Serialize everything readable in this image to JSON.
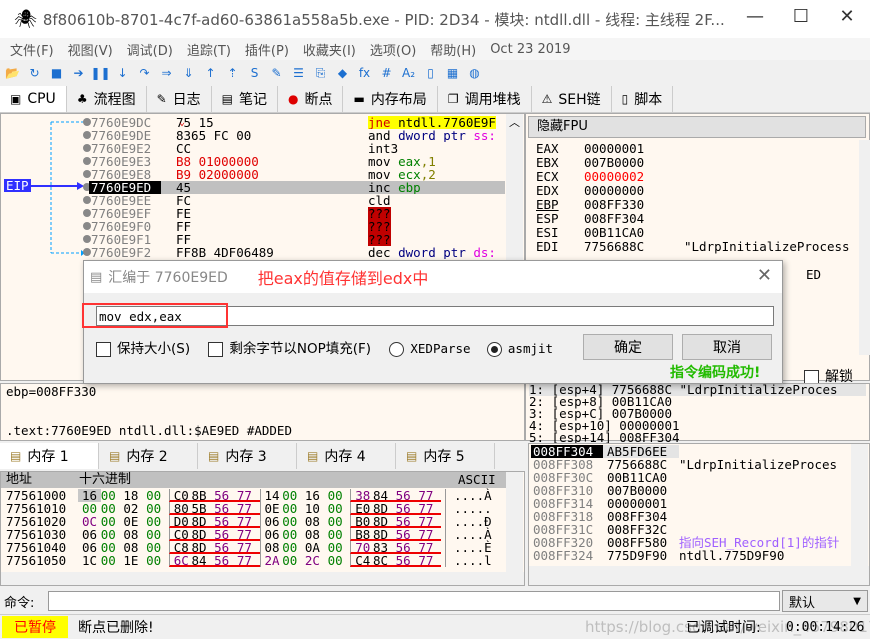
{
  "window": {
    "title": "8f80610b-8701-4c7f-ad60-63861a558a5b.exe - PID: 2D34 - 模块: ntdll.dll - 线程: 主线程 2F...",
    "minimize": "—",
    "maximize": "☐",
    "close": "✕"
  },
  "menu": [
    "文件(F)",
    "视图(V)",
    "调试(D)",
    "追踪(T)",
    "插件(P)",
    "收藏夹(I)",
    "选项(O)",
    "帮助(H)",
    "Oct 23 2019"
  ],
  "toolbar": [
    {
      "icon": "open-icon",
      "glyph": "📂"
    },
    {
      "icon": "restart-icon",
      "glyph": "↻"
    },
    {
      "icon": "stop-icon",
      "glyph": "■"
    },
    {
      "icon": "run-icon",
      "glyph": "➔"
    },
    {
      "icon": "pause-icon",
      "glyph": "❚❚"
    },
    {
      "icon": "step-into-icon",
      "glyph": "↓"
    },
    {
      "icon": "step-over-icon",
      "glyph": "↷"
    },
    {
      "icon": "trace-into-icon",
      "glyph": "⇒"
    },
    {
      "icon": "trace-over-icon",
      "glyph": "⇓"
    },
    {
      "icon": "execute-till-return-icon",
      "glyph": "↑"
    },
    {
      "icon": "run-to-user-code-icon",
      "glyph": "⇡"
    },
    {
      "icon": "scylla-icon",
      "glyph": "S"
    },
    {
      "icon": "patch-icon",
      "glyph": "✎"
    },
    {
      "icon": "comments-icon",
      "glyph": "☰"
    },
    {
      "icon": "labels-icon",
      "glyph": "⎘"
    },
    {
      "icon": "bookmarks-icon",
      "glyph": "◆"
    },
    {
      "icon": "functions-icon",
      "glyph": "fx"
    },
    {
      "icon": "hash-icon",
      "glyph": "#"
    },
    {
      "icon": "strings-icon",
      "glyph": "A₂"
    },
    {
      "icon": "device-icon",
      "glyph": "▯"
    },
    {
      "icon": "calculator-icon",
      "glyph": "▦"
    },
    {
      "icon": "globe-icon",
      "glyph": "◍"
    }
  ],
  "tabs": [
    {
      "label": "CPU",
      "icon": "cpu-icon",
      "glyph": "▣"
    },
    {
      "label": "流程图",
      "icon": "tree-icon",
      "glyph": "♣"
    },
    {
      "label": "日志",
      "icon": "log-icon",
      "glyph": "✎"
    },
    {
      "label": "笔记",
      "icon": "notes-icon",
      "glyph": "▤"
    },
    {
      "label": "断点",
      "icon": "breakpoint-icon",
      "glyph": "●"
    },
    {
      "label": "内存布局",
      "icon": "memory-map-icon",
      "glyph": "▬"
    },
    {
      "label": "调用堆栈",
      "icon": "call-stack-icon",
      "glyph": "❐"
    },
    {
      "label": "SEH链",
      "icon": "seh-icon",
      "glyph": "⚠"
    },
    {
      "label": "脚本",
      "icon": "script-icon",
      "glyph": "▯"
    }
  ],
  "disasm": {
    "eip_label": "EIP",
    "rows": [
      {
        "addr": "7760E9DC",
        "mark": "⌄",
        "bytes": "75 15",
        "instr": [
          [
            "jne ",
            "#d00000",
            "#ffff00"
          ],
          [
            "ntdll.7760E9F",
            "#000",
            "#ffff00"
          ]
        ]
      },
      {
        "addr": "7760E9DE",
        "bytes": "8365 FC 00",
        "instr": [
          [
            "and ",
            "#000"
          ],
          [
            "dword ptr ",
            "#000080"
          ],
          [
            "ss:",
            "#e000e0"
          ]
        ]
      },
      {
        "addr": "7760E9E2",
        "bytes": "CC",
        "instr": [
          [
            "int3",
            "#000"
          ]
        ]
      },
      {
        "addr": "7760E9E3",
        "bytes": "B8 01000000",
        "red": true,
        "instr": [
          [
            "mov ",
            "#000"
          ],
          [
            "eax",
            "#008000"
          ],
          [
            ",1",
            "#808000"
          ]
        ]
      },
      {
        "addr": "7760E9E8",
        "bytes": "B9 02000000",
        "red": true,
        "instr": [
          [
            "mov ",
            "#000"
          ],
          [
            "ecx",
            "#008000"
          ],
          [
            ",2",
            "#808000"
          ]
        ]
      },
      {
        "addr": "7760E9ED",
        "bytes": "45",
        "current": true,
        "instr": [
          [
            "inc ",
            "#000"
          ],
          [
            "ebp",
            "#008000"
          ]
        ]
      },
      {
        "addr": "7760E9EE",
        "bytes": "FC",
        "instr": [
          [
            "cld",
            "#000"
          ]
        ]
      },
      {
        "addr": "7760E9EF",
        "bytes": "FE",
        "instr": [
          [
            "???",
            "#000",
            "#c00000"
          ]
        ]
      },
      {
        "addr": "7760E9F0",
        "bytes": "FF",
        "instr": [
          [
            "???",
            "#000",
            "#c00000"
          ]
        ]
      },
      {
        "addr": "7760E9F1",
        "bytes": "FF",
        "instr": [
          [
            "???",
            "#000",
            "#c00000"
          ]
        ]
      },
      {
        "addr": "7760E9F2",
        "bytes": "FF8B 4DF06489",
        "instr": [
          [
            "dec ",
            "#000"
          ],
          [
            "dword ptr ",
            "#000080"
          ],
          [
            "ds:",
            "#e000e0"
          ]
        ]
      }
    ]
  },
  "registers": {
    "header": "隐藏FPU",
    "rows": [
      {
        "name": "EAX",
        "value": "00000001",
        "comment": ""
      },
      {
        "name": "EBX",
        "value": "007B0000",
        "comment": ""
      },
      {
        "name": "ECX",
        "value": "00000002",
        "comment": "",
        "changed": true
      },
      {
        "name": "EDX",
        "value": "00000000",
        "comment": ""
      },
      {
        "name": "EBP",
        "value": "008FF330",
        "comment": ""
      },
      {
        "name": "ESP",
        "value": "008FF304",
        "comment": ""
      },
      {
        "name": "ESI",
        "value": "00B11CA0",
        "comment": ""
      },
      {
        "name": "EDI",
        "value": "7756688C",
        "comment": "\"LdrpInitializeProcess"
      }
    ],
    "partial": "ED",
    "unlock": "解锁"
  },
  "dialog": {
    "title": "汇编于 7760E9ED",
    "annotation": "把eax的值存储到edx中",
    "input": "mov edx,eax",
    "keep_size": "保持大小(S)",
    "fill_nop": "剩余字节以NOP填充(F)",
    "xedparse": "XEDParse",
    "asmjit": "asmjit",
    "selected": "asmjit",
    "ok": "确定",
    "cancel": "取消",
    "status": "指令编码成功!",
    "close": "✕"
  },
  "info": {
    "lines": [
      "ebp=008FF330",
      "",
      ".text:7760E9ED ntdll.dll:$AE9ED #ADDED"
    ]
  },
  "args": [
    "1: [esp+4] 7756688C \"LdrpInitializeProces",
    "2: [esp+8] 00B11CA0",
    "3: [esp+C] 007B0000",
    "4: [esp+10] 00000001",
    "5: [esp+14] 008FF304"
  ],
  "memory": {
    "tabs": [
      "内存 1",
      "内存 2",
      "内存 3",
      "内存 4",
      "内存 5"
    ],
    "headers": {
      "addr": "地址",
      "hex": "十六进制",
      "ascii": "ASCII"
    },
    "rows": [
      {
        "addr": "77561000",
        "bytes": [
          "16",
          "00",
          "18",
          "00",
          "C0",
          "8B",
          "56",
          "77",
          "14",
          "00",
          "16",
          "00",
          "38",
          "84",
          "56",
          "77"
        ],
        "ascii": "....À"
      },
      {
        "addr": "77561010",
        "bytes": [
          "00",
          "00",
          "02",
          "00",
          "80",
          "5B",
          "56",
          "77",
          "0E",
          "00",
          "10",
          "00",
          "E0",
          "8D",
          "56",
          "77"
        ],
        "ascii": "....."
      },
      {
        "addr": "77561020",
        "bytes": [
          "0C",
          "00",
          "0E",
          "00",
          "D0",
          "8D",
          "56",
          "77",
          "06",
          "00",
          "08",
          "00",
          "B0",
          "8D",
          "56",
          "77"
        ],
        "ascii": "....Đ"
      },
      {
        "addr": "77561030",
        "bytes": [
          "06",
          "00",
          "08",
          "00",
          "C0",
          "8D",
          "56",
          "77",
          "06",
          "00",
          "08",
          "00",
          "B8",
          "8D",
          "56",
          "77"
        ],
        "ascii": "....À"
      },
      {
        "addr": "77561040",
        "bytes": [
          "06",
          "00",
          "08",
          "00",
          "C8",
          "8D",
          "56",
          "77",
          "08",
          "00",
          "0A",
          "00",
          "70",
          "83",
          "56",
          "77"
        ],
        "ascii": "....È"
      },
      {
        "addr": "77561050",
        "bytes": [
          "1C",
          "00",
          "1E",
          "00",
          "6C",
          "84",
          "56",
          "77",
          "2A",
          "00",
          "2C",
          "00",
          "C4",
          "8C",
          "56",
          "77"
        ],
        "ascii": "....l"
      }
    ]
  },
  "stack": {
    "rows": [
      {
        "addr": "008FF304",
        "value": "AB5FD6EE",
        "comment": "",
        "current": true
      },
      {
        "addr": "008FF308",
        "value": "7756688C",
        "comment": "\"LdrpInitializeProces"
      },
      {
        "addr": "008FF30C",
        "value": "00B11CA0",
        "comment": ""
      },
      {
        "addr": "008FF310",
        "value": "007B0000",
        "comment": ""
      },
      {
        "addr": "008FF314",
        "value": "00000001",
        "comment": ""
      },
      {
        "addr": "008FF318",
        "value": "008FF304",
        "comment": ""
      },
      {
        "addr": "008FF31C",
        "value": "008FF32C",
        "comment": ""
      },
      {
        "addr": "008FF320",
        "value": "008FF580",
        "comment": "指向SEH_Record[1]的指针",
        "seh": true
      },
      {
        "addr": "008FF324",
        "value": "775D9F90",
        "comment": "ntdll.775D9F90"
      }
    ]
  },
  "command": {
    "label": "命令:",
    "value": "",
    "mode": "默认"
  },
  "status": {
    "state": "已暂停",
    "message": "断点已删除!",
    "debug_time_label": "已调试时间:",
    "debug_time": "0:00:14:26",
    "watermark": "https://blog.csdn.net/weixin_45798017"
  },
  "colors": {
    "accent": "#3030ff",
    "paused_bg": "#ffff00",
    "paused_fg": "#ff0000",
    "success": "#22bb00",
    "annotation": "#ff3333"
  }
}
